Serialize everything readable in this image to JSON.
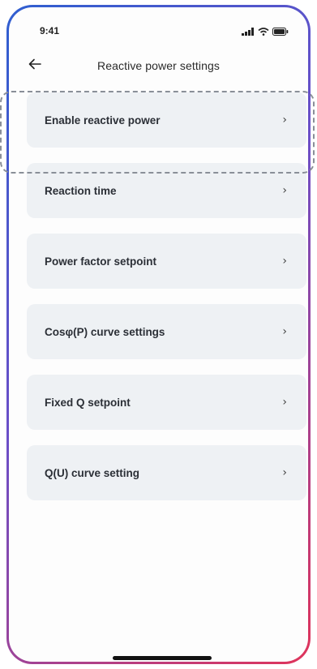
{
  "status_bar": {
    "time": "9:41",
    "icons": [
      "signal-icon",
      "wifi-icon",
      "battery-icon"
    ]
  },
  "header": {
    "back_icon": "arrow-left-icon",
    "title": "Reactive power  settings"
  },
  "menu": {
    "items": [
      {
        "label": "Enable reactive power",
        "chevron": "›"
      },
      {
        "label": "Reaction time",
        "chevron": "›"
      },
      {
        "label": "Power factor setpoint",
        "chevron": "›"
      },
      {
        "label": "Cosφ(P) curve settings",
        "chevron": "›"
      },
      {
        "label": "Fixed Q setpoint",
        "chevron": "›"
      },
      {
        "label": "Q(U) curve setting",
        "chevron": "›"
      }
    ]
  },
  "colors": {
    "item_background": "#eef1f4",
    "frame_gradient_start": "#2f5fd0",
    "frame_gradient_end": "#e0345a",
    "highlight_border": "#8a8f98"
  }
}
